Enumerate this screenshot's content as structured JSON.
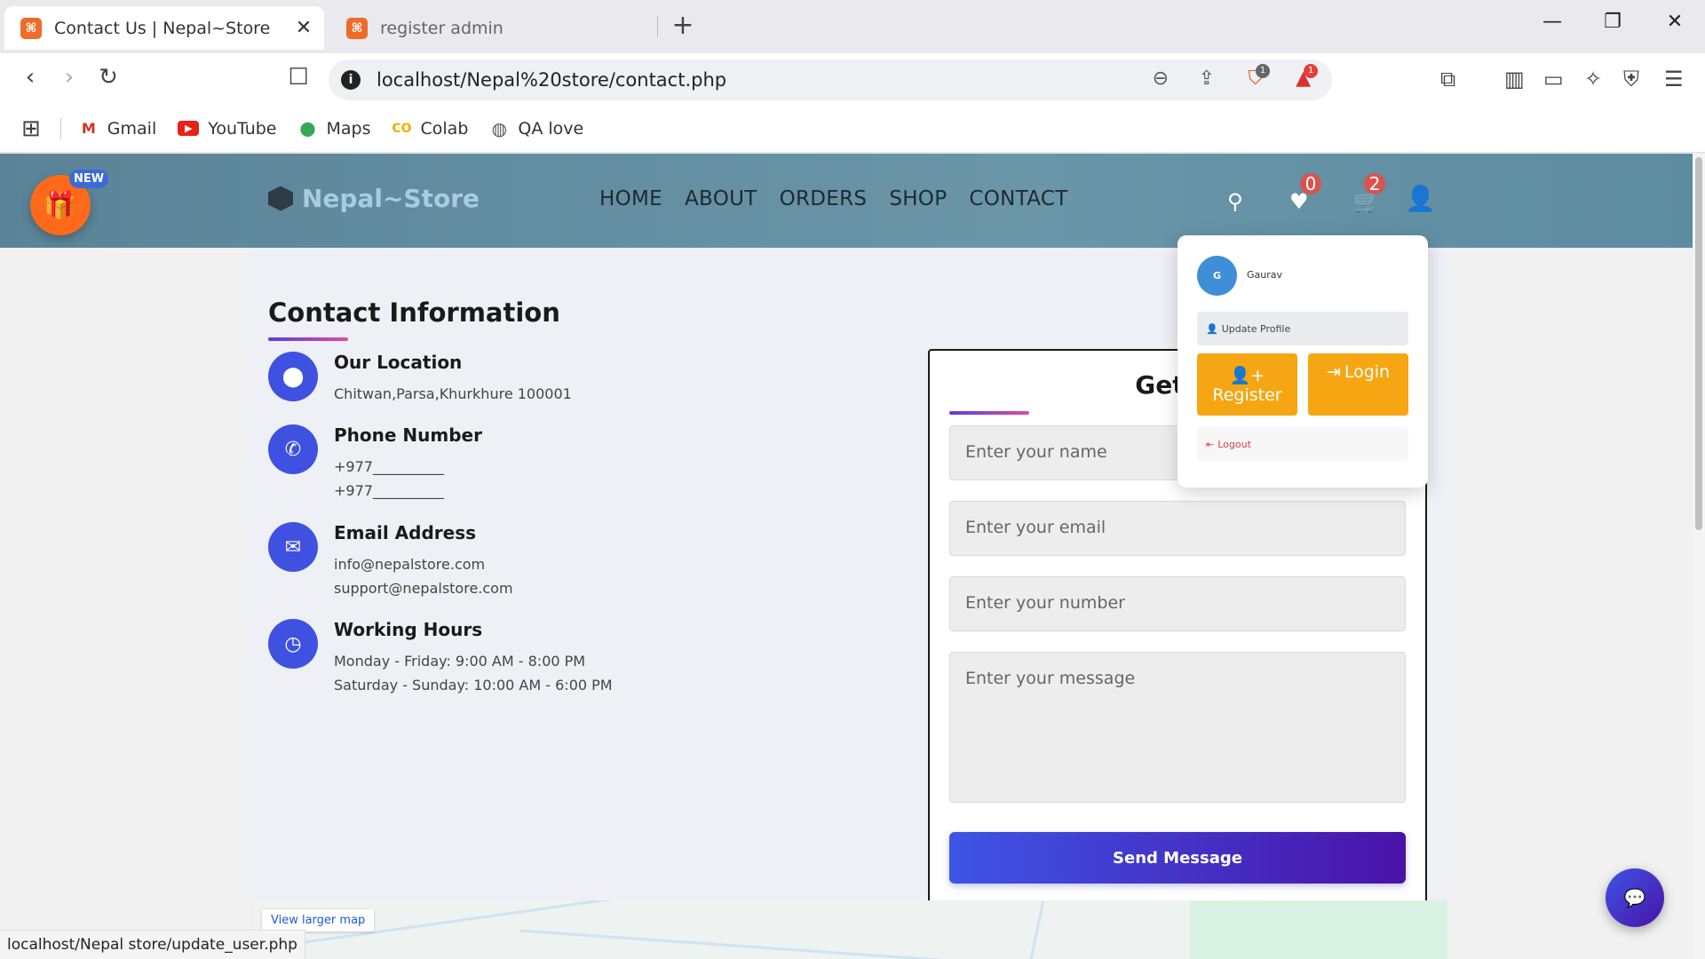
{
  "browser": {
    "tabs": [
      {
        "title": "Contact Us | Nepal~Store",
        "active": true
      },
      {
        "title": "register admin",
        "active": false
      }
    ],
    "url": "localhost/Nepal%20store/contact.php",
    "brave_badge": "1",
    "rewards_badge": "1",
    "bookmarks": [
      {
        "label": "Gmail",
        "icon": "gmail-icon"
      },
      {
        "label": "YouTube",
        "icon": "youtube-icon"
      },
      {
        "label": "Maps",
        "icon": "maps-icon"
      },
      {
        "label": "Colab",
        "icon": "colab-icon"
      },
      {
        "label": "QA love",
        "icon": "globe-icon"
      }
    ],
    "status_url": "localhost/Nepal store/update_user.php"
  },
  "header": {
    "new_badge": "NEW",
    "logo": "Nepal~Store",
    "nav": [
      "HOME",
      "ABOUT",
      "ORDERS",
      "SHOP",
      "CONTACT"
    ],
    "wishlist_count": "0",
    "cart_count": "2"
  },
  "contact": {
    "title": "Contact Information",
    "items": [
      {
        "icon": "location-pin-icon",
        "heading": "Our Location",
        "lines": [
          "Chitwan,Parsa,Khurkhure 100001"
        ]
      },
      {
        "icon": "phone-icon",
        "heading": "Phone Number",
        "lines": [
          "+977__________",
          "+977__________"
        ]
      },
      {
        "icon": "envelope-icon",
        "heading": "Email Address",
        "lines": [
          "info@nepalstore.com",
          "support@nepalstore.com"
        ]
      },
      {
        "icon": "clock-icon",
        "heading": "Working Hours",
        "lines": [
          "Monday - Friday: 9:00 AM - 8:00 PM",
          "Saturday - Sunday: 10:00 AM - 6:00 PM"
        ]
      }
    ]
  },
  "form": {
    "title": "Get In",
    "name_placeholder": "Enter your name",
    "email_placeholder": "Enter your email",
    "number_placeholder": "Enter your number",
    "message_placeholder": "Enter your message",
    "submit": "Send Message"
  },
  "map": {
    "link": "View larger map"
  },
  "user_menu": {
    "avatar_letter": "G",
    "name": "Gaurav",
    "update_profile": "Update Profile",
    "register": "Register",
    "login": "Login",
    "logout": "Logout"
  },
  "colors": {
    "header_bg": "#6a96a8",
    "icon_circle": "#3f51e0",
    "menu_button": "#f5a612",
    "send_button_start": "#3d55e6",
    "send_button_end": "#4a12a8"
  }
}
